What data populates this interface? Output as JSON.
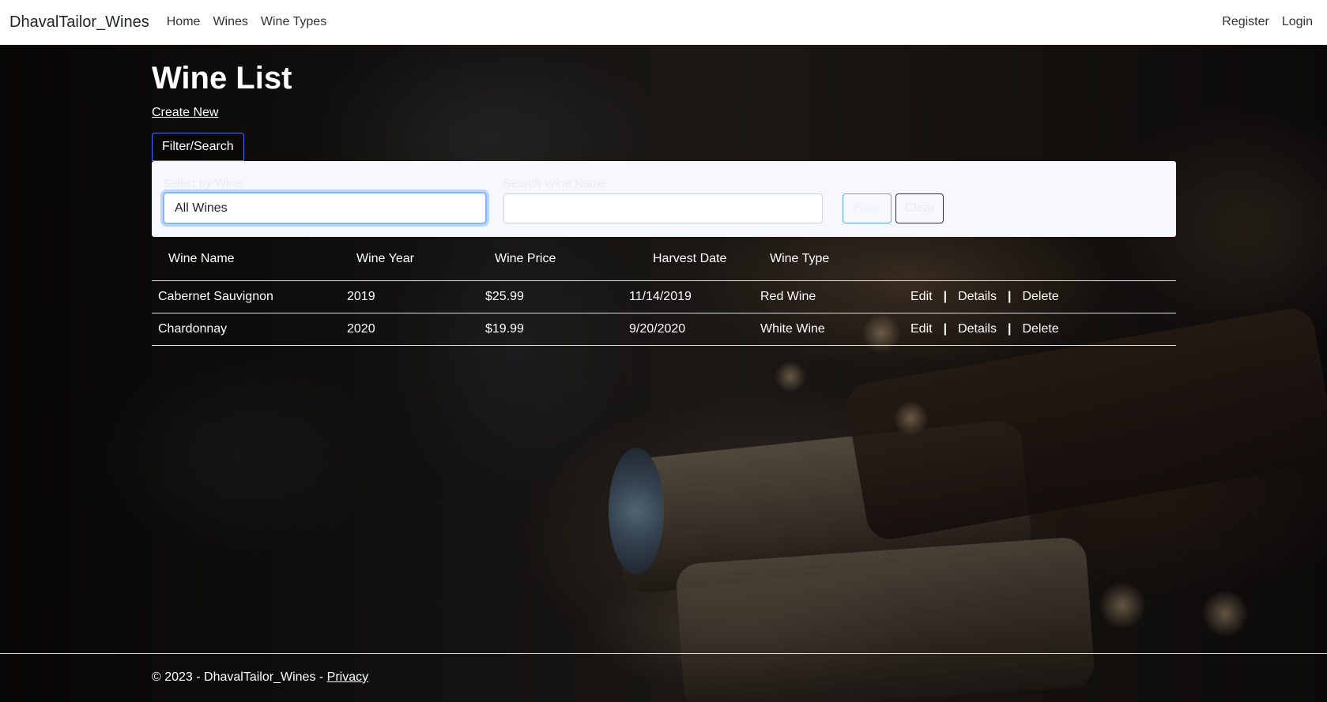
{
  "navbar": {
    "brand": "DhavalTailor_Wines",
    "links": [
      "Home",
      "Wines",
      "Wine Types"
    ],
    "right_links": [
      "Register",
      "Login"
    ]
  },
  "page": {
    "title": "Wine List",
    "create_new": "Create New"
  },
  "filter": {
    "toggle_label": "Filter/Search",
    "select_label": "Select by Wine",
    "select_value": "All Wines",
    "search_label": "Search Wine Name",
    "search_value": "",
    "filter_button": "Filter",
    "clear_button": "Clear"
  },
  "table": {
    "headers": [
      "Wine Name",
      "Wine Year",
      "Wine Price",
      "Harvest Date",
      "Wine Type"
    ],
    "rows": [
      {
        "name": "Cabernet Sauvignon",
        "year": "2019",
        "price": "$25.99",
        "harvest": "11/14/2019",
        "type": "Red Wine"
      },
      {
        "name": "Chardonnay",
        "year": "2020",
        "price": "$19.99",
        "harvest": "9/20/2020",
        "type": "White Wine"
      }
    ],
    "actions": {
      "edit": "Edit",
      "details": "Details",
      "delete": "Delete",
      "separator": "|"
    }
  },
  "footer": {
    "text": "© 2023 - DhavalTailor_Wines - ",
    "privacy": "Privacy"
  }
}
